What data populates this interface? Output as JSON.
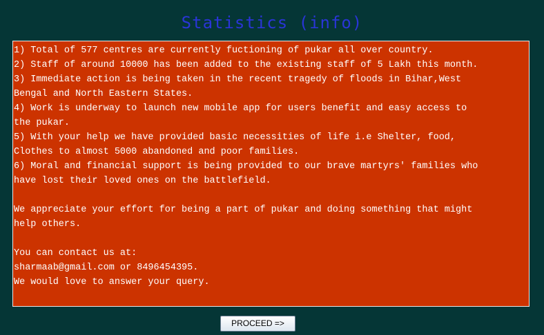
{
  "title": "Statistics (info)",
  "info_lines": [
    "1) Total of 577 centres are currently fuctioning of pukar all over country.",
    "2) Staff of around 10000 has been added to the existing staff of 5 Lakh this month.",
    "3) Immediate action is being taken in the recent tragedy of floods in Bihar,West",
    "Bengal and North Eastern States.",
    "4) Work is underway to launch new mobile app for users benefit and easy access to",
    "the pukar.",
    "5) With your help we have provided basic necessities of life i.e Shelter, food,",
    "Clothes to almost 5000 abandoned and poor families.",
    "6) Moral and financial support is being provided to our brave martyrs' families who",
    "have lost their loved ones on the battlefield.",
    "",
    "We appreciate your effort for being a part of pukar and doing something that might",
    "help others.",
    "",
    "You can contact us at:",
    "sharmaab@gmail.com or 8496454395.",
    "We would love to answer your query."
  ],
  "proceed_label": "PROCEED =>",
  "colors": {
    "background": "#053636",
    "title": "#2a35d6",
    "panel": "#cc3300",
    "panel_text": "#ffffff"
  }
}
